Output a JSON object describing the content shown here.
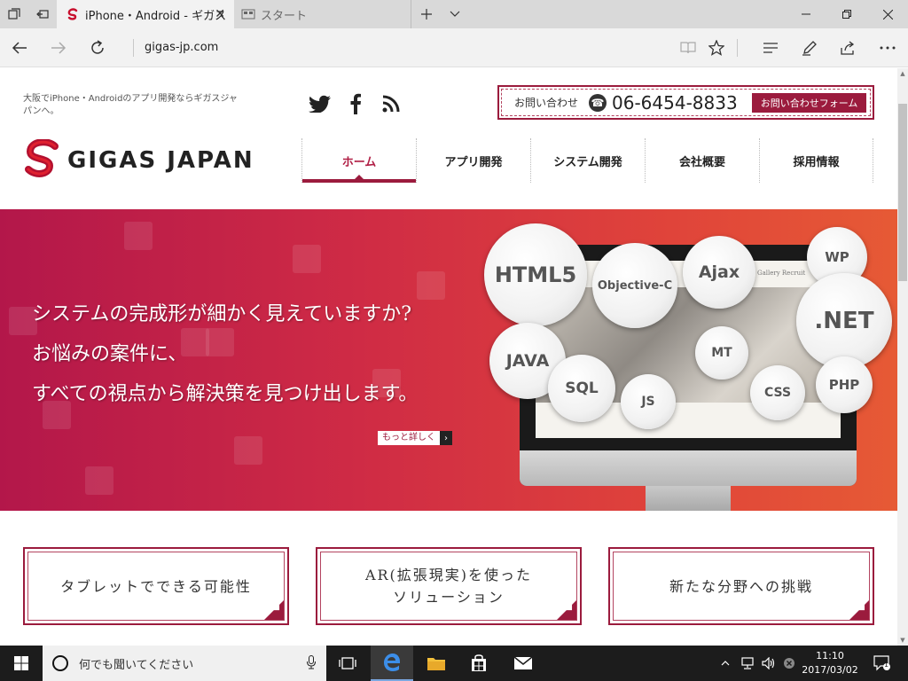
{
  "browser": {
    "tabs": [
      {
        "label": "iPhone・Android - ギガス",
        "active": true
      },
      {
        "label": "スタート",
        "active": false
      }
    ],
    "url": "gigas-jp.com"
  },
  "site": {
    "tagline": "大阪でiPhone・Androidのアプリ開発ならギガスジャパンへ。",
    "contact": {
      "label": "お問い合わせ",
      "phone": "06-6454-8833",
      "button": "お問い合わせフォーム"
    },
    "logo_text": "GIGAS JAPAN",
    "nav": [
      {
        "label": "ホーム",
        "active": true
      },
      {
        "label": "アプリ開発",
        "active": false
      },
      {
        "label": "システム開発",
        "active": false
      },
      {
        "label": "会社概要",
        "active": false
      },
      {
        "label": "採用情報",
        "active": false
      }
    ],
    "hero": {
      "lines": [
        "システムの完成形が細かく見えていますか?",
        "お悩みの案件に、",
        "すべての視点から解決策を見つけ出します。"
      ],
      "more": "もっと詳しく",
      "screen_nav": "Gallery    Recruit",
      "bubbles": [
        "HTML5",
        "Objective-C",
        "Ajax",
        "WP",
        ".NET",
        "JAVA",
        "SQL",
        "JS",
        "MT",
        "CSS",
        "PHP"
      ]
    },
    "features": [
      {
        "line1": "タブレットでできる可能性",
        "line2": ""
      },
      {
        "line1": "AR(拡張現実)を使った",
        "line2": "ソリューション"
      },
      {
        "line1": "新たな分野への挑戦",
        "line2": ""
      }
    ]
  },
  "taskbar": {
    "search_placeholder": "何でも聞いてください",
    "time": "11:10",
    "date": "2017/03/02",
    "notifications": "1"
  },
  "colors": {
    "brand": "#9b1b3d",
    "hero_start": "#b3174a",
    "hero_end": "#e65a35"
  }
}
